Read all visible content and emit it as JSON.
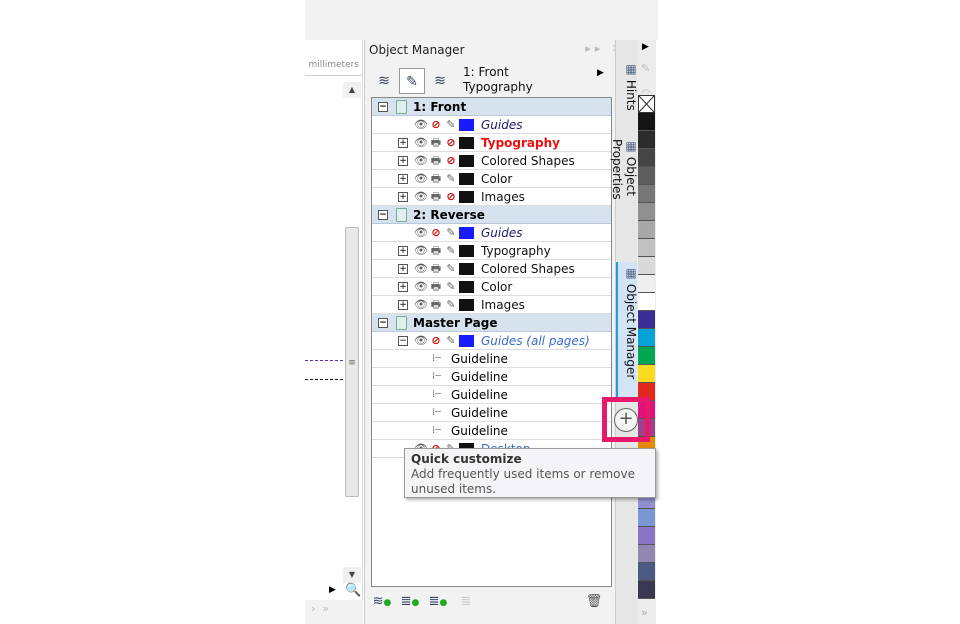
{
  "ruler": {
    "units": "millimeters"
  },
  "panel": {
    "title": "Object Manager",
    "current_layer": [
      "1: Front",
      "Typography"
    ],
    "tree": [
      {
        "type": "page",
        "label": "1: Front"
      },
      {
        "type": "layer",
        "label": "Guides",
        "italic": true,
        "color": "#1a1aff",
        "expander": false,
        "print": false,
        "edit": true,
        "text_color": "#1a1a6a"
      },
      {
        "type": "layer",
        "label": "Typography",
        "active": true,
        "color": "#111111",
        "expander": true,
        "print": true,
        "edit": false,
        "text_color": "#ee1111"
      },
      {
        "type": "layer",
        "label": "Colored Shapes",
        "color": "#111111",
        "expander": true,
        "print": true,
        "edit": false
      },
      {
        "type": "layer",
        "label": "Color",
        "color": "#111111",
        "expander": true,
        "print": true,
        "edit": true
      },
      {
        "type": "layer",
        "label": "Images",
        "color": "#111111",
        "expander": true,
        "print": true,
        "edit": false
      },
      {
        "type": "page",
        "label": "2: Reverse"
      },
      {
        "type": "layer",
        "label": "Guides",
        "italic": true,
        "color": "#1a1aff",
        "expander": false,
        "print": false,
        "edit": true,
        "text_color": "#1a1a6a"
      },
      {
        "type": "layer",
        "label": "Typography",
        "color": "#111111",
        "expander": true,
        "print": true,
        "edit": true
      },
      {
        "type": "layer",
        "label": "Colored Shapes",
        "color": "#111111",
        "expander": true,
        "print": true,
        "edit": true
      },
      {
        "type": "layer",
        "label": "Color",
        "color": "#111111",
        "expander": true,
        "print": true,
        "edit": true
      },
      {
        "type": "layer",
        "label": "Images",
        "color": "#111111",
        "expander": true,
        "print": true,
        "edit": true
      },
      {
        "type": "page",
        "label": "Master Page"
      },
      {
        "type": "layer",
        "label": "Guides (all pages)",
        "italic": true,
        "color": "#1a1aff",
        "expander": "minus",
        "print": false,
        "edit": true,
        "text_color": "#3a6acc"
      },
      {
        "type": "guide",
        "label": "Guideline"
      },
      {
        "type": "guide",
        "label": "Guideline"
      },
      {
        "type": "guide",
        "label": "Guideline"
      },
      {
        "type": "guide",
        "label": "Guideline"
      },
      {
        "type": "guide",
        "label": "Guideline"
      },
      {
        "type": "layer",
        "label": "Desktop",
        "color": "#111111",
        "expander": false,
        "print": false,
        "edit": true,
        "text_color": "#3a6acc"
      }
    ]
  },
  "tabs": [
    {
      "label": "Hints"
    },
    {
      "label": "Object Properties"
    },
    {
      "label": "Object Manager",
      "active": true
    }
  ],
  "palette": [
    "none",
    "#141414",
    "#2c2c2c",
    "#454545",
    "#5e5e5e",
    "#777777",
    "#909090",
    "#a8a8a8",
    "#c1c1c1",
    "#d9d9d9",
    "#efefef",
    "#ffffff",
    "#3a2d96",
    "#08a2d8",
    "#00a651",
    "#f9dc20",
    "#e0281c",
    "#e0127c",
    "#a0418c",
    "#e68800",
    "#f3b6c0",
    "#c4b8e0",
    "#9090d0",
    "#7b96d0",
    "#8a74c6",
    "#9088b0",
    "#4a5a82",
    "#3a3852"
  ],
  "tooltip": {
    "title": "Quick customize",
    "text": "Add frequently used items or remove unused items."
  },
  "quick_customize": {
    "icon": "plus-circle-icon"
  }
}
